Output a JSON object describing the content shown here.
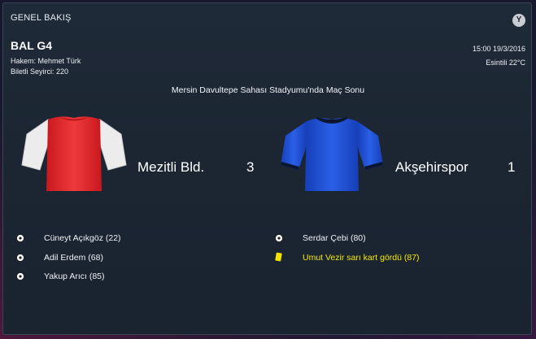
{
  "panel": {
    "title": "GENEL BAKIŞ",
    "close_label": "Y"
  },
  "match": {
    "competition": "BAL G4",
    "referee": "Hakem: Mehmet Türk",
    "attendance": "Biletli Seyirci: 220",
    "datetime": "15:00 19/3/2016",
    "weather": "Esintili 22°C",
    "venue": "Mersin Davultepe Sahası Stadyumu'nda Maç Sonu"
  },
  "home": {
    "name": "Mezitli Bld.",
    "score": "3",
    "kit_body_color": "#e42d32",
    "kit_sleeve_color": "#f1f1f1",
    "events": [
      {
        "icon": "football-icon",
        "text": "Cüneyt Açıkgöz (22)"
      },
      {
        "icon": "football-icon",
        "text": "Adil Erdem (68)"
      },
      {
        "icon": "football-icon",
        "text": "Yakup Arıcı (85)"
      }
    ]
  },
  "away": {
    "name": "Akşehirspor",
    "score": "1",
    "kit_body_color": "#1f4fd8",
    "kit_trim_color": "#0b1630",
    "events": [
      {
        "icon": "football-icon",
        "text": "Serdar Çebi (80)"
      },
      {
        "icon": "yellow-card-icon",
        "text": "Umut Vezir sarı kart gördü (87)"
      }
    ]
  }
}
